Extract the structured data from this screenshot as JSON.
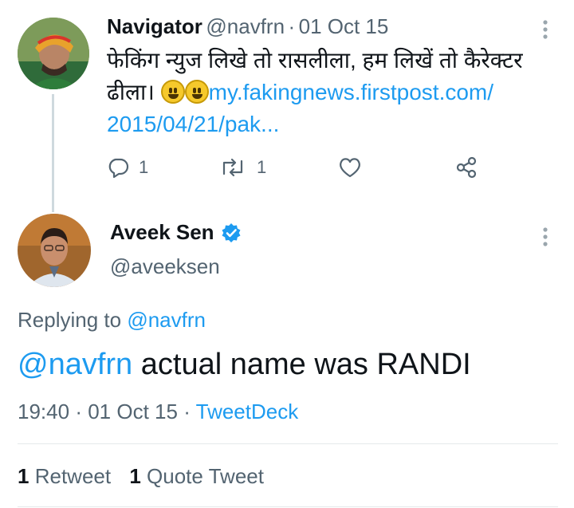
{
  "parent_tweet": {
    "name": "Navigator",
    "handle": "@navfrn",
    "separator": "·",
    "date": "01 Oct 15",
    "text_line1": "फेकिंग न्युज लिखे तो रासलीला, हम लिखें तो कैरेक्टर",
    "text_line2_prefix": "ढीला।",
    "link_line1": "my.fakingnews.firstpost.com/",
    "link_line2": "2015/04/21/pak...",
    "reply_count": "1",
    "retweet_count": "1"
  },
  "main_tweet": {
    "name": "Aveek Sen",
    "handle": "@aveeksen",
    "replying_prefix": "Replying to",
    "replying_handle": "@navfrn",
    "mention": "@navfrn",
    "text": " actual name was RANDI",
    "time": "19:40",
    "date": "01 Oct 15",
    "separator": "·",
    "source": "TweetDeck"
  },
  "stats": {
    "retweet_count": "1",
    "retweet_label": "Retweet",
    "quote_count": "1",
    "quote_label": "Quote Tweet"
  },
  "colors": {
    "accent": "#1d9bf0",
    "muted": "#536471",
    "verified": "#1d9bf0"
  },
  "icons": [
    "reply-icon",
    "retweet-icon",
    "like-icon",
    "share-icon",
    "overflow-menu-icon",
    "verified-badge-icon",
    "smiley-emoji"
  ]
}
